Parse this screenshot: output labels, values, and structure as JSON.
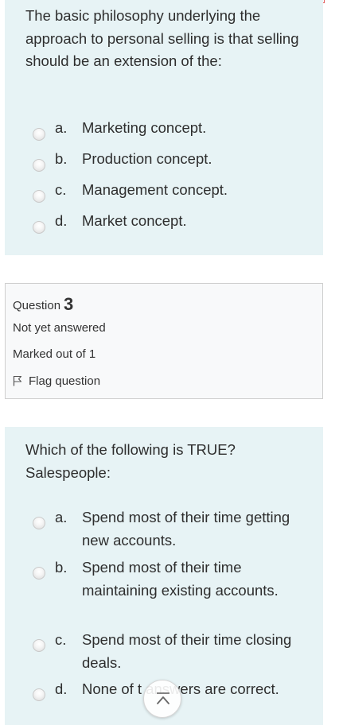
{
  "question2": {
    "text": "The basic philosophy underlying the approach to personal selling is that selling should be an extension of the:",
    "answers": [
      {
        "letter": "a.",
        "text": "Marketing concept."
      },
      {
        "letter": "b.",
        "text": "Production concept."
      },
      {
        "letter": "c.",
        "text": "Management concept."
      },
      {
        "letter": "d.",
        "text": "Market concept."
      }
    ]
  },
  "question3_info": {
    "label": "Question",
    "number": "3",
    "status": "Not yet answered",
    "marks": "Marked out of 1",
    "flag": "Flag question"
  },
  "question3": {
    "text": "Which of the following is TRUE? Salespeople:",
    "answers": [
      {
        "letter": "a.",
        "text": "Spend most of their time getting new accounts."
      },
      {
        "letter": "b.",
        "text": "Spend most of their time maintaining existing accounts."
      },
      {
        "letter": "c.",
        "text": "Spend most of their time closing deals."
      },
      {
        "letter": "d.",
        "text": "None of t   answers are correct."
      }
    ]
  },
  "icons": {
    "flag": "flag-icon",
    "scroll_top": "chevron-up-icon"
  }
}
